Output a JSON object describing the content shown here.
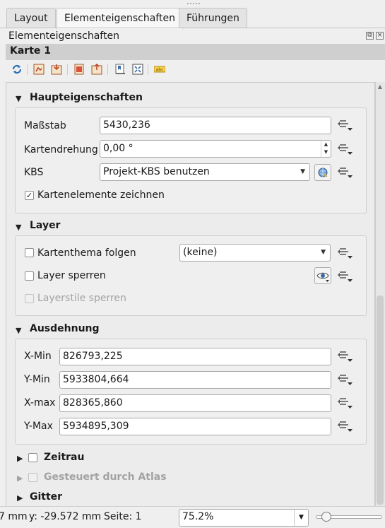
{
  "tabs": [
    "Layout",
    "Elementeigenschaften",
    "Führungen"
  ],
  "dock": {
    "title": "Elementeigenschaften"
  },
  "item": {
    "name": "Karte 1"
  },
  "toolbar_icons": [
    "refresh-icon",
    "map-extent-from-canvas-icon",
    "canvas-extent-from-map-icon",
    "atlas-extent-icon",
    "atlas-extent-to-canvas-icon",
    "bookmark-icon",
    "preview-icon",
    "label-settings-icon"
  ],
  "sections": {
    "main": {
      "title": "Haupteigenschaften",
      "scale_label": "Maßstab",
      "scale_value": "5430,236",
      "rotation_label": "Kartendrehung",
      "rotation_value": "0,00 °",
      "crs_label": "KBS",
      "crs_value": "Projekt-KBS benutzen",
      "draw_items_label": "Kartenelemente zeichnen"
    },
    "layer": {
      "title": "Layer",
      "follow_theme_label": "Kartenthema folgen",
      "theme_value": "(keine)",
      "lock_layers_label": "Layer sperren",
      "lock_styles_label": "Layerstile sperren"
    },
    "extent": {
      "title": "Ausdehnung",
      "xmin_label": "X-Min",
      "xmin_value": "826793,225",
      "ymin_label": "Y-Min",
      "ymin_value": "5933804,664",
      "xmax_label": "X-max",
      "xmax_value": "828365,860",
      "ymax_label": "Y-Max",
      "ymax_value": "5934895,309"
    },
    "temporal": {
      "title": "Zeitrau"
    },
    "atlas": {
      "title": "Gesteuert durch Atlas"
    },
    "grid": {
      "title": "Gitter"
    }
  },
  "status": {
    "x_text": "7 mm",
    "y_text": "y: -29.572 mm",
    "page_text": "Seite: 1",
    "zoom_value": "75.2%",
    "zoom_slider": 0.1
  }
}
